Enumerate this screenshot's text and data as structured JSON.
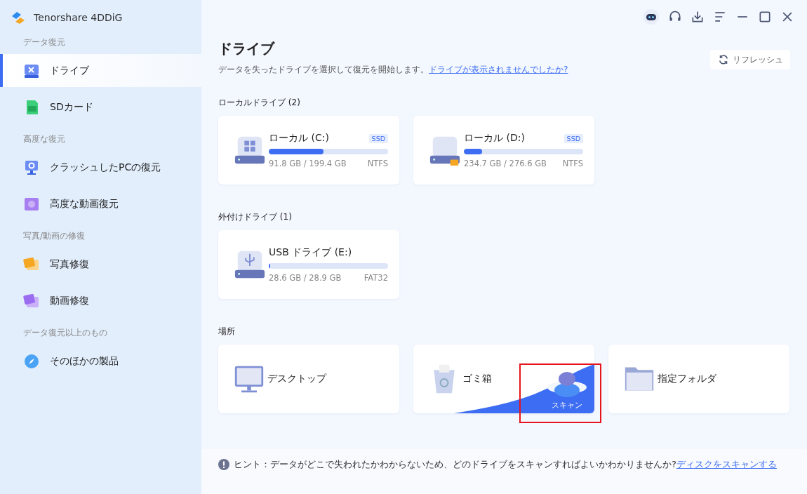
{
  "app": {
    "name": "Tenorshare 4DDiG"
  },
  "sidebar": {
    "sections": [
      {
        "heading": "データ復元",
        "items": [
          {
            "label": "ドライブ",
            "kind": "drive",
            "selected": true
          },
          {
            "label": "SDカード",
            "kind": "sd",
            "selected": false
          }
        ]
      },
      {
        "heading": "高度な復元",
        "items": [
          {
            "label": "クラッシュしたPCの復元",
            "kind": "pc",
            "selected": false
          },
          {
            "label": "高度な動画復元",
            "kind": "video",
            "selected": false
          }
        ]
      },
      {
        "heading": "写真/動画の修復",
        "items": [
          {
            "label": "写真修復",
            "kind": "photo",
            "selected": false
          },
          {
            "label": "動画修復",
            "kind": "film",
            "selected": false
          }
        ]
      },
      {
        "heading": "データ復元以上のもの",
        "items": [
          {
            "label": "そのほかの製品",
            "kind": "compass",
            "selected": false
          }
        ]
      }
    ]
  },
  "header": {
    "title": "ドライブ",
    "subtitle": "データを失ったドライブを選択して復元を開始します。",
    "help_link": "ドライブが表示されませんでしたか?",
    "refresh": "リフレッシュ"
  },
  "groups": [
    {
      "heading": "ローカルドライブ (2)",
      "drives": [
        {
          "name": "ローカル (C:)",
          "badge": "SSD",
          "level": 0.46,
          "usage": "91.8 GB / 199.4 GB",
          "filesystem": "NTFS",
          "kind": "windows"
        },
        {
          "name": "ローカル (D:)",
          "badge": "SSD",
          "level": 0.15,
          "usage": "234.7 GB / 276.6 GB",
          "filesystem": "NTFS",
          "kind": "locked"
        }
      ]
    },
    {
      "heading": "外付けドライブ (1)",
      "drives": [
        {
          "name": "USB ドライブ (E:)",
          "level": 0.01,
          "usage": "28.6 GB / 28.9 GB",
          "filesystem": "FAT32",
          "kind": "usb"
        }
      ]
    }
  ],
  "locations": {
    "heading": "場所",
    "items": [
      {
        "label": "デスクトップ",
        "kind": "desktop",
        "hovered": false
      },
      {
        "label": "ゴミ箱",
        "kind": "trash",
        "hovered": true,
        "scan_label": "スキャン"
      },
      {
        "label": "指定フォルダ",
        "kind": "folder",
        "hovered": false
      }
    ]
  },
  "hint": {
    "label": "ヒント：",
    "text": "データがどこで失われたかわからないため、どのドライブをスキャンすればよいかわかりませんか?",
    "link": "ディスクをスキャンする"
  }
}
